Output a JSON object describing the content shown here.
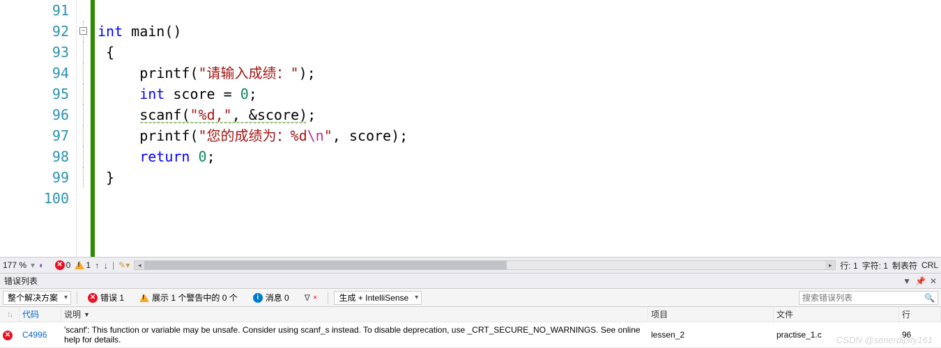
{
  "editor": {
    "lines": [
      91,
      92,
      93,
      94,
      95,
      96,
      97,
      98,
      99,
      100
    ],
    "code": {
      "fn_decl_kw": "int",
      "fn_decl_name": "main",
      "fn_decl_paren": "()",
      "brace_open": "{",
      "l94_fn": "printf",
      "l94_str": "\"请输入成绩：\"",
      "l94_tail": ");",
      "l95_kw": "int",
      "l95_id": "score",
      "l95_eq": " = ",
      "l95_num": "0",
      "l95_tail": ";",
      "l96_fn": "scanf",
      "l96_str": "\"%d,\"",
      "l96_mid": ", &",
      "l96_id": "score",
      "l96_tail": ");",
      "l97_fn": "printf",
      "l97_str1": "\"您的成绩为：%d",
      "l97_esc": "\\n",
      "l97_str2": "\"",
      "l97_mid": ", ",
      "l97_id": "score",
      "l97_tail": ");",
      "l98_kw": "return",
      "l98_num": "0",
      "l98_tail": ";",
      "brace_close": "}"
    }
  },
  "toolbar": {
    "zoom": "177 %",
    "err_count": "0",
    "warn_count": "1",
    "status_line": "行: 1",
    "status_char": "字符: 1",
    "status_tab": "制表符",
    "status_crlf": "CRL"
  },
  "panel": {
    "title": "错误列表",
    "scope": "整个解决方案",
    "errors_label": "错误 1",
    "warnings_label": "展示 1 个警告中的 0 个",
    "messages_label": "消息 0",
    "build_mode": "生成 + IntelliSense",
    "search_placeholder": "搜索错误列表"
  },
  "grid": {
    "headers": {
      "code": "代码",
      "desc": "说明",
      "proj": "项目",
      "file": "文件",
      "line": "行"
    },
    "row": {
      "code": "C4996",
      "desc": "'scanf': This function or variable may be unsafe. Consider using scanf_s instead. To disable deprecation, use _CRT_SECURE_NO_WARNINGS. See online help for details.",
      "proj": "lessen_2",
      "file": "practise_1.c",
      "line": "96"
    }
  },
  "watermark": "CSDN @senerdipity161"
}
